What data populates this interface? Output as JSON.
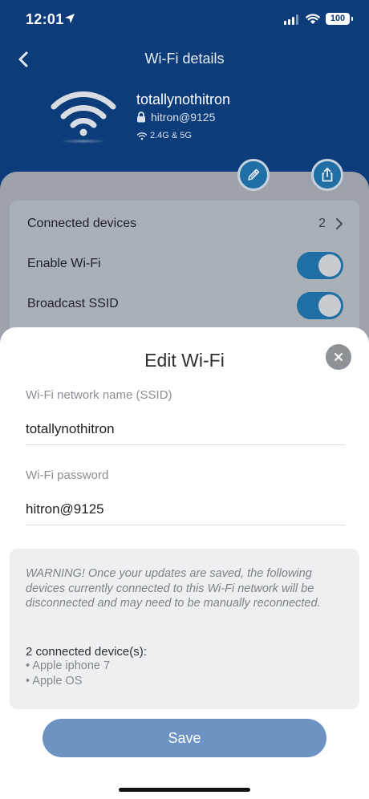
{
  "status_bar": {
    "time": "12:01",
    "battery": "100"
  },
  "nav": {
    "title": "Wi-Fi details"
  },
  "network": {
    "ssid": "totallynothitron",
    "password": "hitron@9125",
    "bands": "2.4G & 5G"
  },
  "settings": {
    "connected_devices_label": "Connected devices",
    "connected_devices_count": "2",
    "enable_wifi_label": "Enable Wi-Fi",
    "enable_wifi_on": true,
    "broadcast_ssid_label": "Broadcast SSID",
    "broadcast_ssid_on": true
  },
  "sheet": {
    "title": "Edit Wi-Fi",
    "ssid_label": "Wi-Fi network name (SSID)",
    "ssid_value": "totallynothitron",
    "password_label": "Wi-Fi password",
    "password_value": "hitron@9125",
    "warning": "WARNING! Once your updates are saved, the following devices currently connected to this Wi-Fi network will be disconnected and may need to be manually reconnected.",
    "devices_title": "2 connected device(s):",
    "devices": [
      "• Apple iphone 7",
      "• Apple OS"
    ],
    "save_label": "Save"
  },
  "colors": {
    "header_blue": "#0c3c79",
    "accent_blue": "#1f6fa5",
    "save_button": "#6d93c2"
  }
}
